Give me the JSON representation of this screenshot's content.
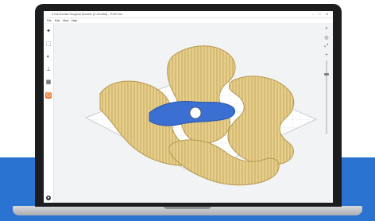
{
  "window": {
    "title": "3 full Dental Surgical Models (3 Dentist) - PreForm",
    "controls": [
      "–",
      "□",
      "✕"
    ]
  },
  "menu": [
    "File",
    "Edit",
    "View",
    "Help"
  ],
  "toolbar": {
    "tools": [
      {
        "icon": "magic-wand-icon",
        "glyph": "✦"
      },
      {
        "icon": "select-box-icon",
        "glyph": "⬚"
      },
      {
        "icon": "orient-icon",
        "glyph": "◐"
      },
      {
        "icon": "support-icon",
        "glyph": "⊥"
      },
      {
        "icon": "layout-icon",
        "glyph": "▦"
      },
      {
        "icon": "print-icon",
        "glyph": "⎙",
        "active": true
      }
    ],
    "bottom_glyph": "●"
  },
  "view_controls": {
    "search_glyph": "⌕",
    "items": [
      "◎",
      "⤢",
      "+",
      "−"
    ]
  },
  "colors": {
    "accent": "#e8772e",
    "model_resin": "#e3c983",
    "selected_model": "#3b6fd1",
    "build_plate": "#ffffff",
    "band": "#2a73d0"
  }
}
